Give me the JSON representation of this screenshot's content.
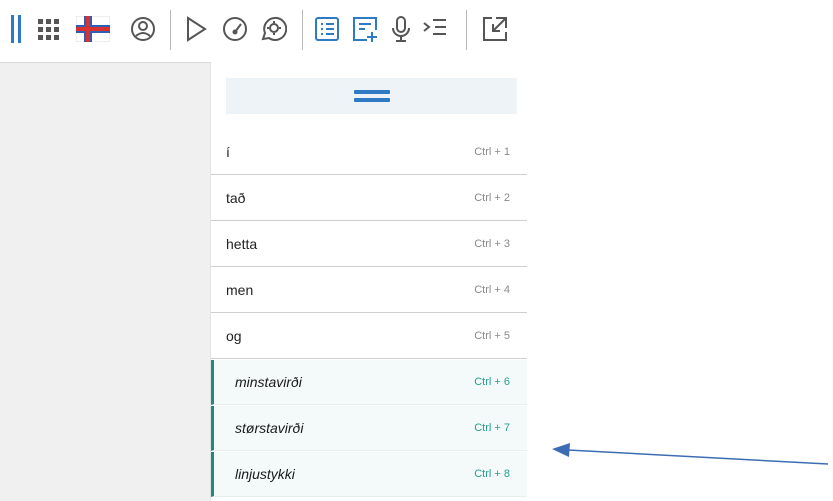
{
  "toolbar": {
    "icons": [
      "drag-handle-icon",
      "grid-icon",
      "faroese-flag-icon",
      "person-circle-icon",
      "play-icon",
      "gauge-icon",
      "settings-speech-icon",
      "list-icon",
      "add-list-icon",
      "microphone-icon",
      "indent-list-icon",
      "resize-icon"
    ]
  },
  "menu": {
    "icon": "hamburger-icon",
    "accent_color": "#1f8a80",
    "items": [
      {
        "word": "í",
        "shortcut": "Ctrl + 1"
      },
      {
        "word": "tað",
        "shortcut": "Ctrl + 2"
      },
      {
        "word": "hetta",
        "shortcut": "Ctrl + 3"
      },
      {
        "word": "men",
        "shortcut": "Ctrl + 4"
      },
      {
        "word": "og",
        "shortcut": "Ctrl + 5"
      }
    ],
    "options": [
      {
        "label": "minstavirði",
        "shortcut": "Ctrl + 6"
      },
      {
        "label": "størstavirði",
        "shortcut": "Ctrl + 7"
      },
      {
        "label": "linjustykki",
        "shortcut": "Ctrl + 8"
      }
    ]
  },
  "annotation": {
    "arrow_color": "#3c6db4"
  }
}
